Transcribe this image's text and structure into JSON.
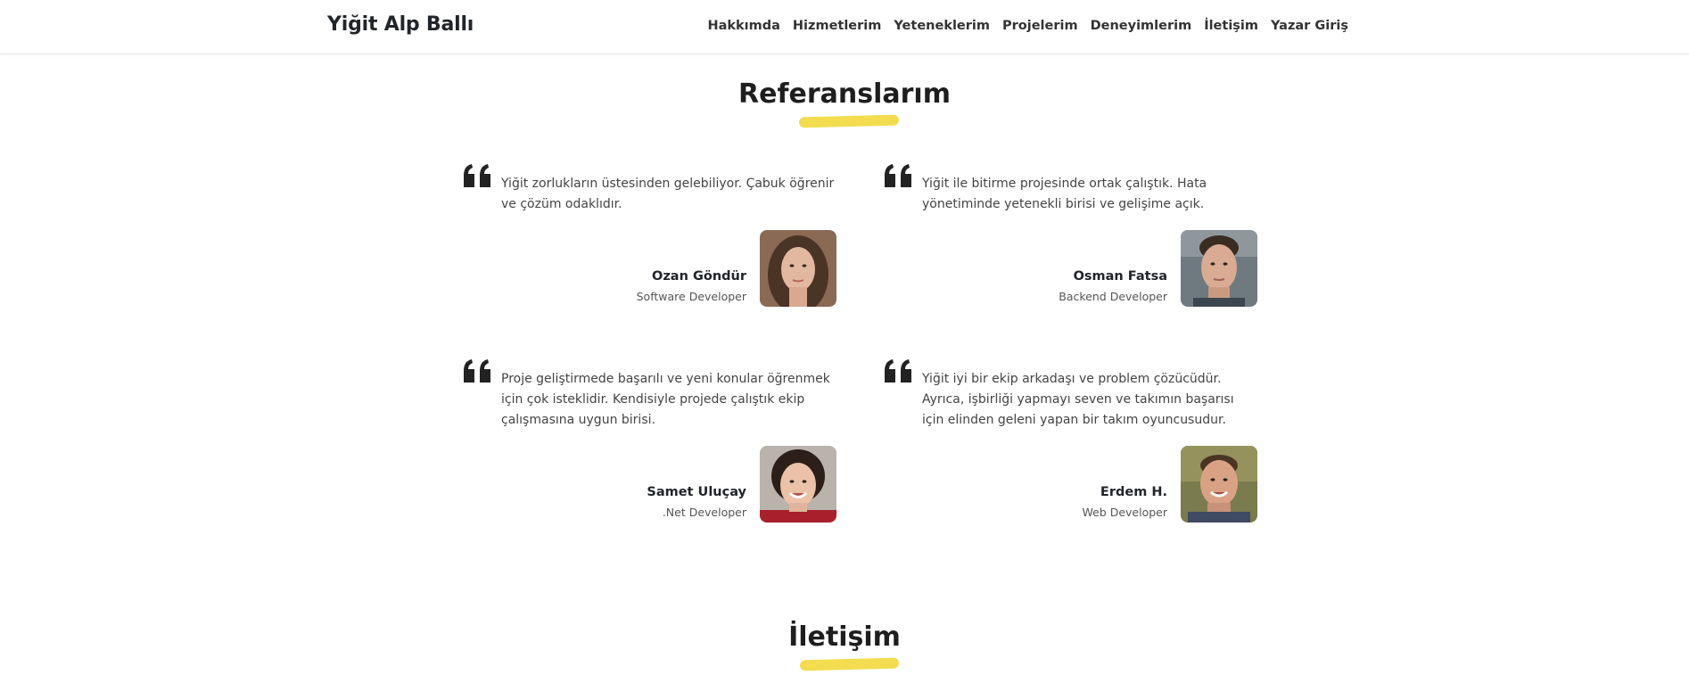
{
  "header": {
    "brand": "Yiğit Alp Ballı",
    "nav": [
      "Hakkımda",
      "Hizmetlerim",
      "Yeteneklerim",
      "Projelerim",
      "Deneyimlerim",
      "İletişim",
      "Yazar Giriş"
    ]
  },
  "references": {
    "title": "Referanslarım",
    "items": [
      {
        "text": "Yiğit zorlukların üstesinden gelebiliyor. Çabuk öğrenir ve çözüm odaklıdır.",
        "name": "Ozan Göndür",
        "role": "Software Developer"
      },
      {
        "text": "Yiğit ile bitirme projesinde ortak çalıştık. Hata yönetiminde yetenekli birisi ve gelişime açık.",
        "name": "Osman Fatsa",
        "role": "Backend Developer"
      },
      {
        "text": "Proje geliştirmede başarılı ve yeni konular öğrenmek için çok isteklidir. Kendisiyle projede çalıştık ekip çalışmasına uygun birisi.",
        "name": "Samet Uluçay",
        "role": ".Net Developer"
      },
      {
        "text": "Yiğit iyi bir ekip arkadaşı ve problem çözücüdür. Ayrıca, işbirliği yapmayı seven ve takımın başarısı için elinden geleni yapan bir takım oyuncusudur.",
        "name": "Erdem H.",
        "role": "Web Developer"
      }
    ]
  },
  "contact": {
    "title": "İletişim"
  },
  "colors": {
    "accent_underline": "#f3dc4f",
    "quote_icon": "#222222"
  }
}
